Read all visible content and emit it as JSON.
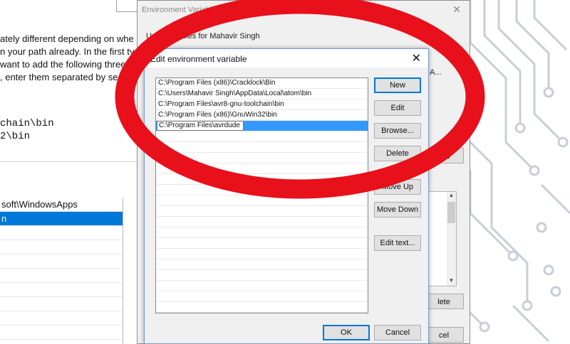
{
  "background_article": {
    "text_lines": [
      "ately different depending on whe",
      "n your path already. In the first ty",
      "want to add the following three",
      ", enter them separated by se"
    ],
    "code_lines": [
      "chain\\bin",
      "2\\bin"
    ]
  },
  "background_list": {
    "items": [
      "soft\\WindowsApps",
      "n",
      "",
      "",
      "",
      "",
      "",
      "",
      "",
      ""
    ],
    "selected_index": 1
  },
  "env_window": {
    "title": "Environment Variables",
    "close_glyph": "✕",
    "user_vars_label": "User variables for Mahavir Singh",
    "right_col_value": "A...",
    "delete_label_1": "lete",
    "move_up_fragment": "M",
    "delete_label_2": "lete",
    "cancel_label": "cel"
  },
  "edit_dialog": {
    "title": "Edit environment variable",
    "close_glyph": "✕",
    "paths": [
      "C:\\Program Files (x86)\\Cracklock\\Bin",
      "C:\\Users\\Mahavir Singh\\AppData\\Local\\atom\\bin",
      "C:\\Program Files\\avr8-gnu-toolchain\\bin",
      "C:\\Program Files (x86)\\GnuWin32\\bin",
      "C:\\Program Files\\avrdude"
    ],
    "editing_index": 4,
    "buttons": {
      "new": "New",
      "edit": "Edit",
      "browse": "Browse...",
      "delete": "Delete",
      "move_up": "Move Up",
      "move_down": "Move Down",
      "edit_text": "Edit text...",
      "ok": "OK",
      "cancel": "Cancel"
    }
  },
  "colors": {
    "annotation_red": "#e8101a",
    "selection_blue": "#3399ff",
    "accent_blue": "#0078d7"
  }
}
